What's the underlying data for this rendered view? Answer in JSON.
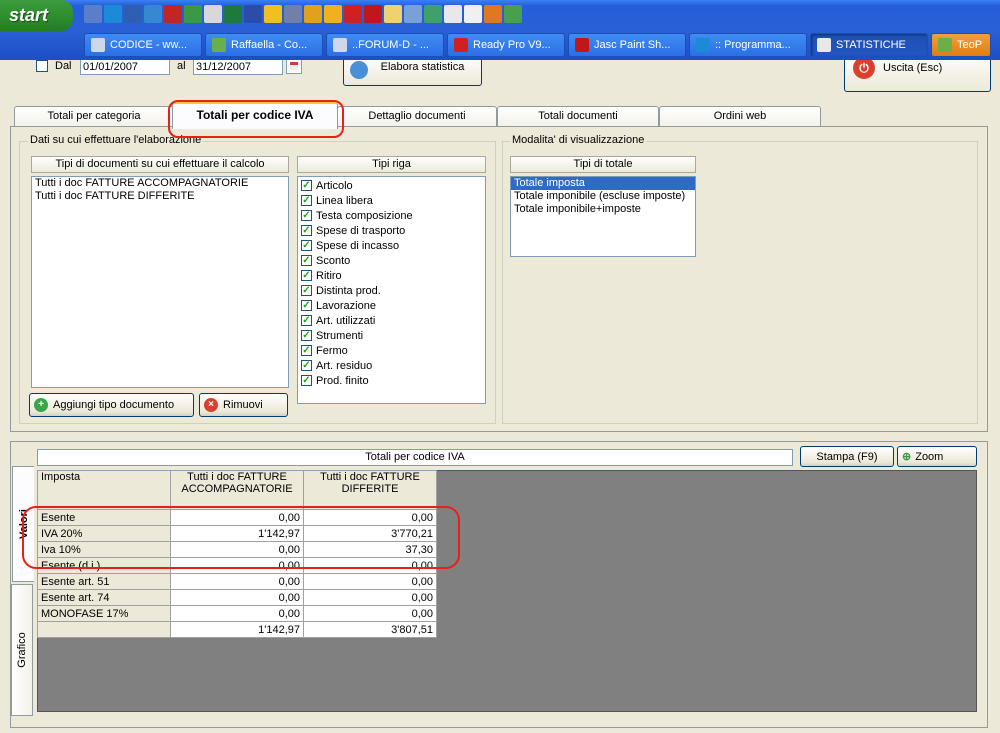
{
  "taskbar": {
    "start_label": "start",
    "quick_launch": [
      {
        "icon": "media-icon",
        "color": "#5a7ec9"
      },
      {
        "icon": "ie-icon",
        "color": "#1d8ad8"
      },
      {
        "icon": "outlook-icon",
        "color": "#2f5fb0"
      },
      {
        "icon": "ie2-icon",
        "color": "#3688d0"
      },
      {
        "icon": "acrobat-icon",
        "color": "#c42424"
      },
      {
        "icon": "calc-icon",
        "color": "#3a9a44"
      },
      {
        "icon": "notepad-icon",
        "color": "#d8d8d8"
      },
      {
        "icon": "excel-icon",
        "color": "#1e7a3a"
      },
      {
        "icon": "word-icon",
        "color": "#2b4ca8"
      },
      {
        "icon": "clock-icon",
        "color": "#f0c020"
      },
      {
        "icon": "network-icon",
        "color": "#7080a8"
      },
      {
        "icon": "tool-icon",
        "color": "#e0a020"
      },
      {
        "icon": "play-icon",
        "color": "#f0b020"
      },
      {
        "icon": "strawberry-icon",
        "color": "#d02020"
      },
      {
        "icon": "paint-icon",
        "color": "#c01818"
      },
      {
        "icon": "folder-icon",
        "color": "#f0d070"
      },
      {
        "icon": "app-icon",
        "color": "#7aa0d8"
      },
      {
        "icon": "refresh-icon",
        "color": "#3fa06a"
      },
      {
        "icon": "doc-icon",
        "color": "#e8e8e8"
      },
      {
        "icon": "pen-icon",
        "color": "#f0f0f0"
      },
      {
        "icon": "firefox-icon",
        "color": "#e07820"
      },
      {
        "icon": "globe-icon",
        "color": "#4aa04a"
      }
    ],
    "tasks": [
      {
        "label": "CODICE - ww...",
        "icon_color": "#cfd8e8"
      },
      {
        "label": "Raffaella - Co...",
        "icon_color": "#6ab04a"
      },
      {
        "label": "..FORUM-D - ...",
        "icon_color": "#cfd8e8"
      },
      {
        "label": "Ready Pro V9...",
        "icon_color": "#d02020"
      },
      {
        "label": "Jasc Paint Sh...",
        "icon_color": "#c01818"
      },
      {
        "label": ":: Programma...",
        "icon_color": "#1d8ad8"
      },
      {
        "label": "STATISTICHE",
        "icon_color": "#e8e8e8"
      },
      {
        "label": "TeoP",
        "icon_color": "#6ab04a"
      }
    ]
  },
  "filters": {
    "dal_label": "Dal",
    "dal_value": "01/01/2007",
    "al_label": "al",
    "al_value": "31/12/2007",
    "elabora_label": "Elabora statistica",
    "uscita_label": "Uscita (Esc)"
  },
  "tabs": [
    {
      "label": "Totali per categoria",
      "active": false
    },
    {
      "label": "Totali per codice IVA",
      "active": true
    },
    {
      "label": "Dettaglio documenti",
      "active": false
    },
    {
      "label": "Totali documenti",
      "active": false
    },
    {
      "label": "Ordini web",
      "active": false
    }
  ],
  "dati": {
    "group_title": "Dati su cui effettuare l'elaborazione",
    "doc_header": "Tipi di documenti su cui effettuare il calcolo",
    "doc_items": [
      "Tutti i doc FATTURE ACCOMPAGNATORIE",
      "Tutti i doc FATTURE DIFFERITE"
    ],
    "riga_header": "Tipi riga",
    "riga_items": [
      "Articolo",
      "Linea libera",
      "Testa composizione",
      "Spese di trasporto",
      "Spese di incasso",
      "Sconto",
      "Ritiro",
      "Distinta prod.",
      "Lavorazione",
      "Art. utilizzati",
      "Strumenti",
      "Fermo",
      "Art. residuo",
      "Prod. finito"
    ],
    "aggiungi_label": "Aggiungi tipo documento",
    "rimuovi_label": "Rimuovi"
  },
  "modalita": {
    "group_title": "Modalita' di visualizzazione",
    "header": "Tipi di totale",
    "items": [
      "Totale imposta",
      "Totale imponibile (escluse imposte)",
      "Totale imponibile+imposte"
    ],
    "selected": "Totale imposta"
  },
  "results": {
    "title": "Totali per codice IVA",
    "stampa_label": "Stampa (F9)",
    "zoom_label": "Zoom",
    "vtab_valori": "Valori",
    "vtab_grafico": "Grafico",
    "columns": [
      "Imposta",
      "Tutti i doc FATTURE ACCOMPAGNATORIE",
      "Tutti i doc FATTURE DIFFERITE"
    ],
    "rows": [
      {
        "label": "Esente",
        "v1": "0,00",
        "v2": "0,00"
      },
      {
        "label": "IVA 20%",
        "v1": "1'142,97",
        "v2": "3'770,21"
      },
      {
        "label": "Iva 10%",
        "v1": "0,00",
        "v2": "37,30"
      },
      {
        "label": "Esente (d.i.)",
        "v1": "0,00",
        "v2": "0,00"
      },
      {
        "label": "Esente art. 51",
        "v1": "0,00",
        "v2": "0,00"
      },
      {
        "label": "Esente art. 74",
        "v1": "0,00",
        "v2": "0,00"
      },
      {
        "label": "MONOFASE 17%",
        "v1": "0,00",
        "v2": "0,00"
      }
    ],
    "totals": {
      "label": "",
      "v1": "1'142,97",
      "v2": "3'807,51"
    }
  }
}
